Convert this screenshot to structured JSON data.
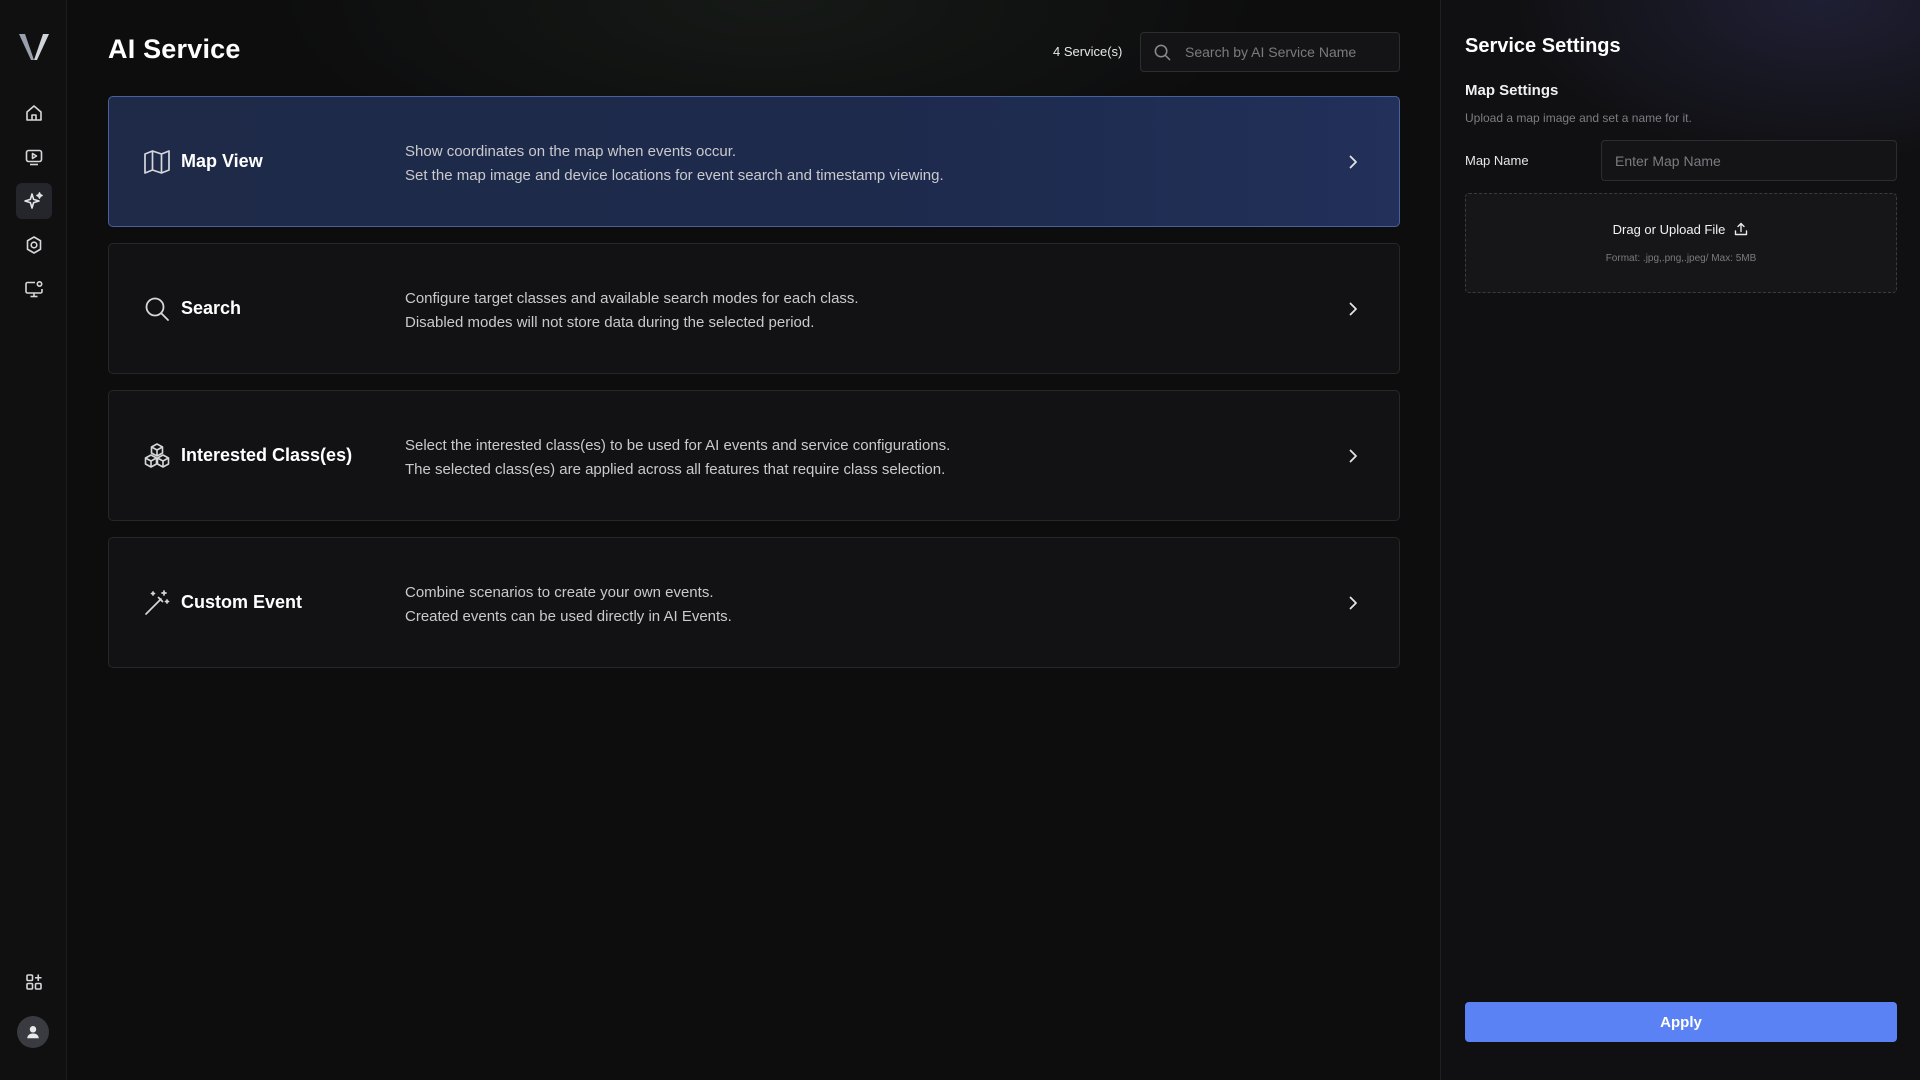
{
  "colors": {
    "accent": "#5a82f5",
    "selected_card_border": "#4a5f9e",
    "background": "#0d0d0e"
  },
  "nav": {
    "logo_icon": "v-logo-icon",
    "items": [
      {
        "icon": "home-icon"
      },
      {
        "icon": "video-playback-icon"
      },
      {
        "icon": "ai-sparkle-icon",
        "active": true
      },
      {
        "icon": "settings-gear-icon"
      },
      {
        "icon": "monitor-settings-icon"
      }
    ],
    "bottom_items": [
      {
        "icon": "apps-grid-add-icon"
      },
      {
        "icon": "user-avatar-icon"
      }
    ]
  },
  "main": {
    "title": "AI Service",
    "service_count": "4 Service(s)",
    "search": {
      "placeholder": "Search by AI Service Name",
      "value": ""
    },
    "services": [
      {
        "icon": "map-icon",
        "title": "Map View",
        "desc_line1": "Show coordinates on the map when events occur.",
        "desc_line2": "Set the map image and device locations for event search and timestamp viewing.",
        "selected": true
      },
      {
        "icon": "search-icon",
        "title": "Search",
        "desc_line1": "Configure target classes and available search modes for each class.",
        "desc_line2": "Disabled modes will not store data during the selected period.",
        "selected": false
      },
      {
        "icon": "cubes-icon",
        "title": "Interested Class(es)",
        "desc_line1": "Select the interested class(es) to be used for AI events and service configurations.",
        "desc_line2": "The selected class(es) are applied across all features that require class selection.",
        "selected": false
      },
      {
        "icon": "magic-wand-icon",
        "title": "Custom Event",
        "desc_line1": "Combine scenarios to create your own events.",
        "desc_line2": "Created events can be used directly in AI Events.",
        "selected": false
      }
    ]
  },
  "panel": {
    "title": "Service Settings",
    "section_title": "Map Settings",
    "section_desc": "Upload a map image and set a name for it.",
    "map_name_label": "Map Name",
    "map_name_placeholder": "Enter Map Name",
    "map_name_value": "",
    "upload_label": "Drag or Upload File",
    "upload_hint": "Format: .jpg,.png,.jpeg/ Max: 5MB",
    "apply_label": "Apply"
  }
}
